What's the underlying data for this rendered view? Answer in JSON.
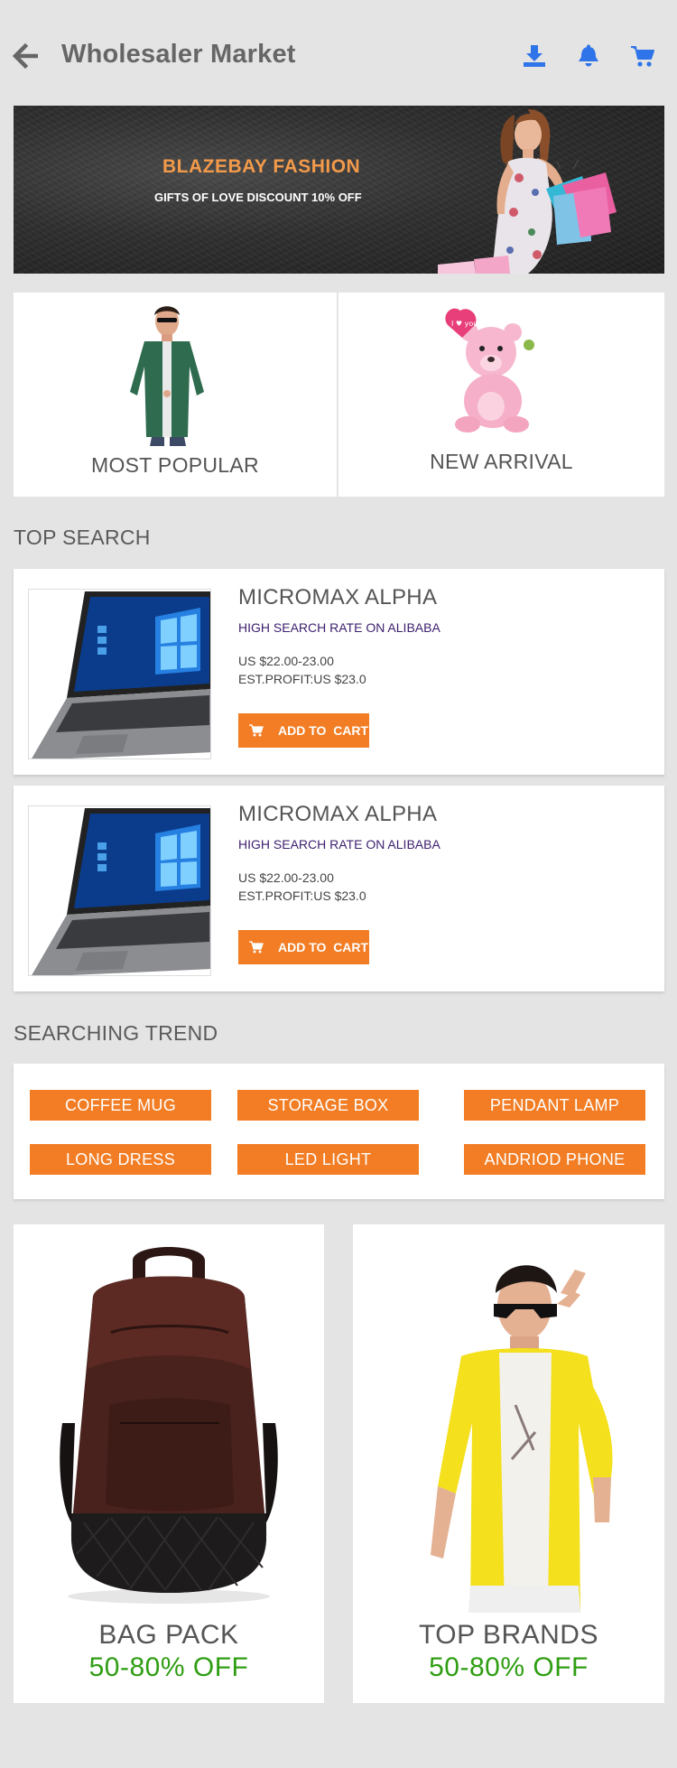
{
  "header": {
    "title": "Wholesaler Market",
    "icons": {
      "back": "back-arrow-icon",
      "download": "download-icon",
      "notifications": "bell-icon",
      "cart": "cart-icon"
    },
    "icon_color": "#2f74e8"
  },
  "banner": {
    "title": "BLAZEBAY FASHION",
    "subtitle": "GIFTS OF LOVE DISCOUNT 10% OFF"
  },
  "categories": [
    {
      "label": "MOST POPULAR"
    },
    {
      "label": "NEW ARRIVAL"
    }
  ],
  "top_search": {
    "title": "TOP SEARCH",
    "products": [
      {
        "name": "MICROMAX ALPHA",
        "rate": "HIGH SEARCH RATE ON ALIBABA",
        "price": "US $22.00-23.00",
        "profit": "EST.PROFIT:US $23.0",
        "button": "ADD TO  CART"
      },
      {
        "name": "MICROMAX ALPHA",
        "rate": "HIGH SEARCH RATE ON ALIBABA",
        "price": "US $22.00-23.00",
        "profit": "EST.PROFIT:US $23.0",
        "button": "ADD TO  CART"
      }
    ]
  },
  "searching_trend": {
    "title": "SEARCHING TREND",
    "tags": [
      "COFFEE MUG",
      "STORAGE BOX",
      "PENDANT LAMP",
      "LONG DRESS",
      "LED LIGHT",
      "ANDRIOD PHONE"
    ]
  },
  "promos": [
    {
      "title": "BAG PACK",
      "offer": "50-80% OFF"
    },
    {
      "title": "TOP BRANDS",
      "offer": "50-80% OFF"
    }
  ],
  "colors": {
    "accent": "#f27d24",
    "offer_green": "#2f9e13",
    "banner_title": "#f39a4a"
  }
}
